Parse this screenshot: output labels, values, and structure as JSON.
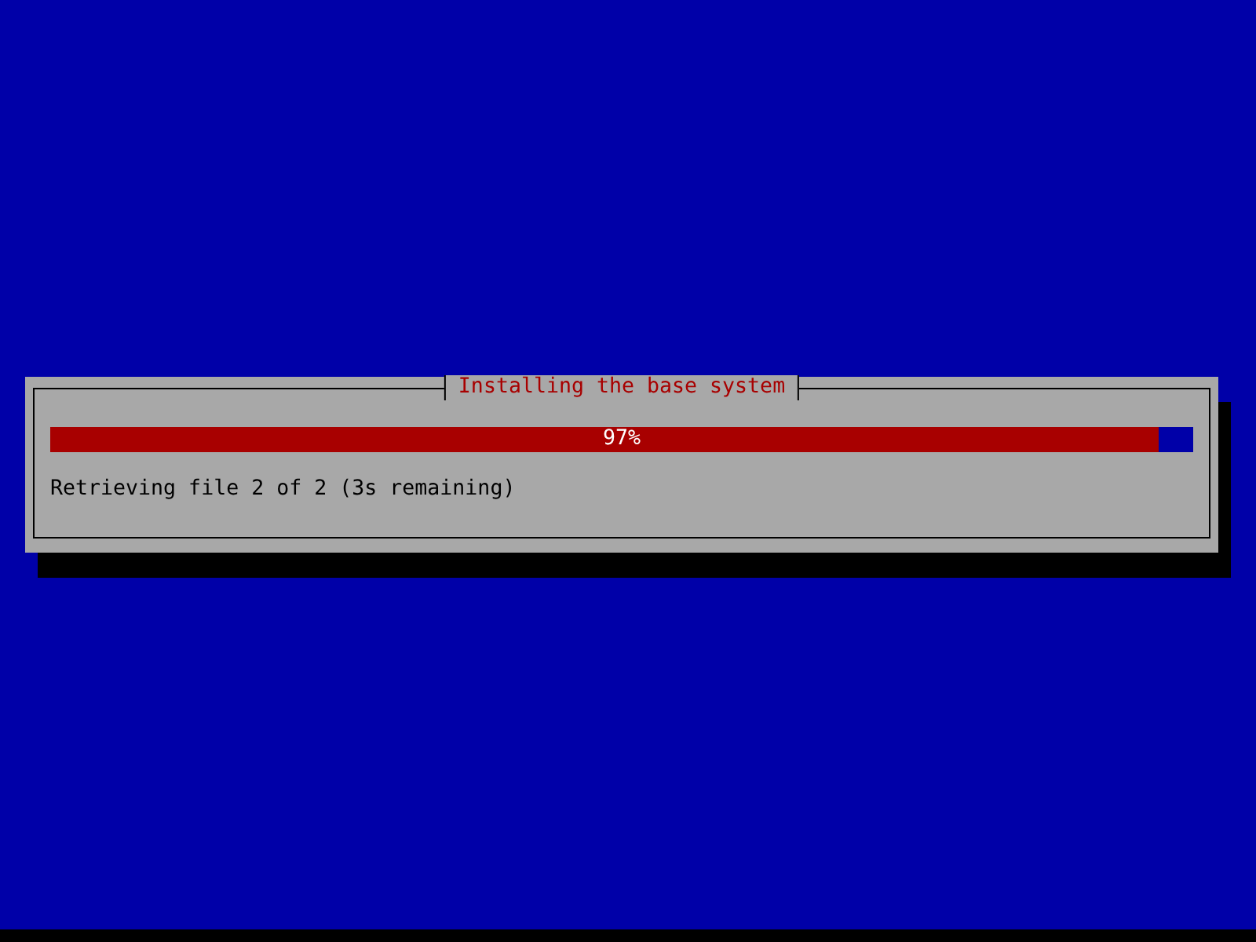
{
  "dialog": {
    "title": "Installing the base system",
    "progress": {
      "level": 0.97,
      "reading": "97%"
    },
    "status": "Retrieving file 2 of 2 (3s remaining)"
  }
}
